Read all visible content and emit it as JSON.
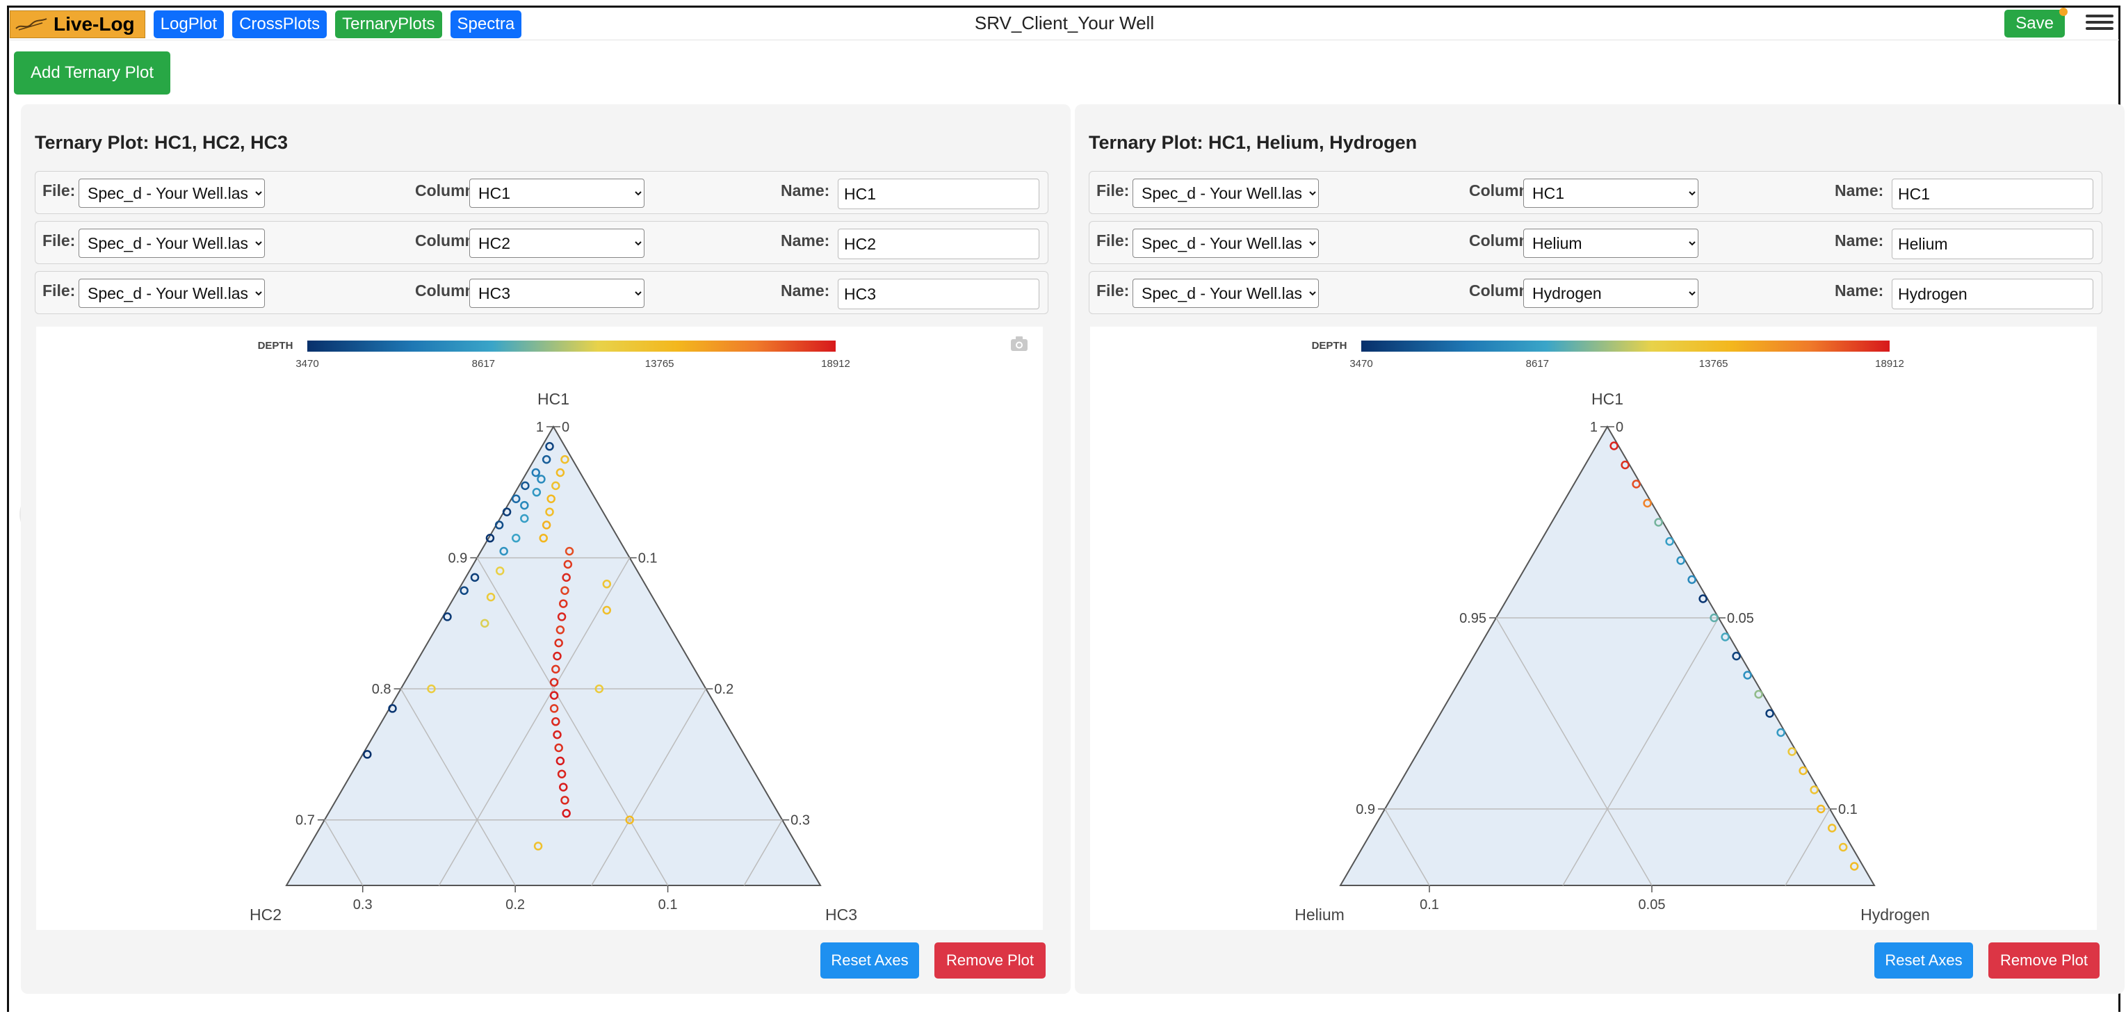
{
  "app": {
    "brand": "Live-Log",
    "window_title": "SRV_Client_Your Well",
    "nav": [
      "LogPlot",
      "CrossPlots",
      "TernaryPlots",
      "Spectra"
    ],
    "active_nav": "TernaryPlots",
    "save_label": "Save",
    "add_label": "Add Ternary Plot"
  },
  "colors": {
    "primary": "#0d6efd",
    "success": "#28a745",
    "danger": "#dc3545",
    "info": "#1e90f0",
    "brand": "#f0a830"
  },
  "panels": [
    {
      "title": "Ternary Plot: HC1, HC2, HC3",
      "rows": [
        {
          "file_label": "File:",
          "file": "Spec_d - Your Well.las",
          "column_label": "Column:",
          "column": "HC1",
          "name_label": "Name:",
          "name": "HC1"
        },
        {
          "file_label": "File:",
          "file": "Spec_d - Your Well.las",
          "column_label": "Column:",
          "column": "HC2",
          "name_label": "Name:",
          "name": "HC2"
        },
        {
          "file_label": "File:",
          "file": "Spec_d - Your Well.las",
          "column_label": "Column:",
          "column": "HC3",
          "name_label": "Name:",
          "name": "HC3"
        }
      ],
      "reset_label": "Reset Axes",
      "remove_label": "Remove Plot"
    },
    {
      "title": "Ternary Plot: HC1, Helium, Hydrogen",
      "rows": [
        {
          "file_label": "File:",
          "file": "Spec_d - Your Well.las",
          "column_label": "Column:",
          "column": "HC1",
          "name_label": "Name:",
          "name": "HC1"
        },
        {
          "file_label": "File:",
          "file": "Spec_d - Your Well.las",
          "column_label": "Column:",
          "column": "Helium",
          "name_label": "Name:",
          "name": "Helium"
        },
        {
          "file_label": "File:",
          "file": "Spec_d - Your Well.las",
          "column_label": "Column:",
          "column": "Hydrogen",
          "name_label": "Name:",
          "name": "Hydrogen"
        }
      ],
      "reset_label": "Reset Axes",
      "remove_label": "Remove Plot"
    }
  ],
  "chart_data": [
    {
      "type": "scatter",
      "subtype": "ternary",
      "colorbar": {
        "title": "DEPTH",
        "ticks": [
          3470,
          8617,
          13765,
          18912
        ],
        "colorscale": [
          "#08306b",
          "#1f78b4",
          "#3aa5c8",
          "#e8d24a",
          "#f3b71e",
          "#ef7a2a",
          "#d7191c"
        ]
      },
      "axes": {
        "a": {
          "title": "HC1",
          "min": 0.65,
          "ticks": [
            "1",
            "0.9",
            "0.8",
            "0.7"
          ]
        },
        "b": {
          "title": "HC2",
          "ticks": [
            "0.3",
            "0.2",
            "0.1"
          ]
        },
        "c": {
          "title": "HC3",
          "ticks": [
            "0",
            "0.1",
            "0.2",
            "0.3"
          ]
        }
      },
      "points": [
        {
          "hc1": 0.985,
          "hc3": 0.005,
          "depth": 4200
        },
        {
          "hc1": 0.975,
          "hc3": 0.008,
          "depth": 5100
        },
        {
          "hc1": 0.965,
          "hc3": 0.006,
          "depth": 6300
        },
        {
          "hc1": 0.955,
          "hc3": 0.004,
          "depth": 4800
        },
        {
          "hc1": 0.945,
          "hc3": 0.003,
          "depth": 5500
        },
        {
          "hc1": 0.935,
          "hc3": 0.002,
          "depth": 3900
        },
        {
          "hc1": 0.925,
          "hc3": 0.002,
          "depth": 4500
        },
        {
          "hc1": 0.915,
          "hc3": 0.001,
          "depth": 3600
        },
        {
          "hc1": 0.96,
          "hc3": 0.012,
          "depth": 7200
        },
        {
          "hc1": 0.95,
          "hc3": 0.014,
          "depth": 7800
        },
        {
          "hc1": 0.94,
          "hc3": 0.011,
          "depth": 7000
        },
        {
          "hc1": 0.93,
          "hc3": 0.016,
          "depth": 8200
        },
        {
          "hc1": 0.915,
          "hc3": 0.018,
          "depth": 8500
        },
        {
          "hc1": 0.905,
          "hc3": 0.015,
          "depth": 7600
        },
        {
          "hc1": 0.885,
          "hc3": 0.006,
          "depth": 4000
        },
        {
          "hc1": 0.875,
          "hc3": 0.004,
          "depth": 4300
        },
        {
          "hc1": 0.855,
          "hc3": 0.003,
          "depth": 3800
        },
        {
          "hc1": 0.785,
          "hc3": 0.002,
          "depth": 3700
        },
        {
          "hc1": 0.75,
          "hc3": 0.003,
          "depth": 3500
        },
        {
          "hc1": 0.89,
          "hc3": 0.02,
          "depth": 11500
        },
        {
          "hc1": 0.87,
          "hc3": 0.024,
          "depth": 12000
        },
        {
          "hc1": 0.85,
          "hc3": 0.03,
          "depth": 11000
        },
        {
          "hc1": 0.8,
          "hc3": 0.02,
          "depth": 11800
        },
        {
          "hc1": 0.975,
          "hc3": 0.02,
          "depth": 13000
        },
        {
          "hc1": 0.965,
          "hc3": 0.022,
          "depth": 13400
        },
        {
          "hc1": 0.955,
          "hc3": 0.024,
          "depth": 12800
        },
        {
          "hc1": 0.945,
          "hc3": 0.026,
          "depth": 13600
        },
        {
          "hc1": 0.935,
          "hc3": 0.03,
          "depth": 13200
        },
        {
          "hc1": 0.925,
          "hc3": 0.033,
          "depth": 14000
        },
        {
          "hc1": 0.915,
          "hc3": 0.036,
          "depth": 13800
        },
        {
          "hc1": 0.905,
          "hc3": 0.058,
          "depth": 17500
        },
        {
          "hc1": 0.895,
          "hc3": 0.062,
          "depth": 18000
        },
        {
          "hc1": 0.885,
          "hc3": 0.066,
          "depth": 18500
        },
        {
          "hc1": 0.875,
          "hc3": 0.07,
          "depth": 17800
        },
        {
          "hc1": 0.865,
          "hc3": 0.074,
          "depth": 18200
        },
        {
          "hc1": 0.855,
          "hc3": 0.078,
          "depth": 18600
        },
        {
          "hc1": 0.845,
          "hc3": 0.082,
          "depth": 17900
        },
        {
          "hc1": 0.835,
          "hc3": 0.086,
          "depth": 18300
        },
        {
          "hc1": 0.825,
          "hc3": 0.09,
          "depth": 18700
        },
        {
          "hc1": 0.815,
          "hc3": 0.094,
          "depth": 18100
        },
        {
          "hc1": 0.805,
          "hc3": 0.098,
          "depth": 18400
        },
        {
          "hc1": 0.795,
          "hc3": 0.103,
          "depth": 18800
        },
        {
          "hc1": 0.785,
          "hc3": 0.108,
          "depth": 18000
        },
        {
          "hc1": 0.775,
          "hc3": 0.114,
          "depth": 18500
        },
        {
          "hc1": 0.765,
          "hc3": 0.12,
          "depth": 18700
        },
        {
          "hc1": 0.755,
          "hc3": 0.126,
          "depth": 18300
        },
        {
          "hc1": 0.745,
          "hc3": 0.132,
          "depth": 18900
        },
        {
          "hc1": 0.735,
          "hc3": 0.138,
          "depth": 18600
        },
        {
          "hc1": 0.725,
          "hc3": 0.144,
          "depth": 18800
        },
        {
          "hc1": 0.715,
          "hc3": 0.15,
          "depth": 18500
        },
        {
          "hc1": 0.705,
          "hc3": 0.156,
          "depth": 18900
        },
        {
          "hc1": 0.88,
          "hc3": 0.095,
          "depth": 12500
        },
        {
          "hc1": 0.86,
          "hc3": 0.105,
          "depth": 13000
        },
        {
          "hc1": 0.8,
          "hc3": 0.13,
          "depth": 12000
        },
        {
          "hc1": 0.7,
          "hc3": 0.2,
          "depth": 13500
        },
        {
          "hc1": 0.68,
          "hc3": 0.15,
          "depth": 12800
        }
      ]
    },
    {
      "type": "scatter",
      "subtype": "ternary",
      "colorbar": {
        "title": "DEPTH",
        "ticks": [
          3470,
          8617,
          13765,
          18912
        ],
        "colorscale": [
          "#08306b",
          "#1f78b4",
          "#3aa5c8",
          "#e8d24a",
          "#f3b71e",
          "#ef7a2a",
          "#d7191c"
        ]
      },
      "axes": {
        "a": {
          "title": "HC1",
          "min": 0.88,
          "ticks": [
            "1",
            "0.95",
            "0.9"
          ]
        },
        "b": {
          "title": "Helium",
          "ticks": [
            "0.1",
            "0.05"
          ]
        },
        "c": {
          "title": "Hydrogen",
          "ticks": [
            "0",
            "0.05",
            "0.1"
          ]
        }
      },
      "points": [
        {
          "hc1": 0.995,
          "h2": 0.004,
          "depth": 18600
        },
        {
          "hc1": 0.99,
          "h2": 0.009,
          "depth": 18300
        },
        {
          "hc1": 0.985,
          "h2": 0.014,
          "depth": 17500
        },
        {
          "hc1": 0.98,
          "h2": 0.019,
          "depth": 16000
        },
        {
          "hc1": 0.975,
          "h2": 0.024,
          "depth": 9500
        },
        {
          "hc1": 0.97,
          "h2": 0.029,
          "depth": 8200
        },
        {
          "hc1": 0.965,
          "h2": 0.034,
          "depth": 7600
        },
        {
          "hc1": 0.96,
          "h2": 0.039,
          "depth": 7000
        },
        {
          "hc1": 0.955,
          "h2": 0.044,
          "depth": 3700
        },
        {
          "hc1": 0.95,
          "h2": 0.049,
          "depth": 9200
        },
        {
          "hc1": 0.945,
          "h2": 0.054,
          "depth": 8800
        },
        {
          "hc1": 0.94,
          "h2": 0.059,
          "depth": 4100
        },
        {
          "hc1": 0.935,
          "h2": 0.064,
          "depth": 7400
        },
        {
          "hc1": 0.93,
          "h2": 0.069,
          "depth": 9900
        },
        {
          "hc1": 0.925,
          "h2": 0.074,
          "depth": 3900
        },
        {
          "hc1": 0.92,
          "h2": 0.079,
          "depth": 8000
        },
        {
          "hc1": 0.915,
          "h2": 0.084,
          "depth": 12200
        },
        {
          "hc1": 0.91,
          "h2": 0.089,
          "depth": 13100
        },
        {
          "hc1": 0.905,
          "h2": 0.094,
          "depth": 12600
        },
        {
          "hc1": 0.9,
          "h2": 0.098,
          "depth": 13500
        },
        {
          "hc1": 0.895,
          "h2": 0.103,
          "depth": 13000
        },
        {
          "hc1": 0.89,
          "h2": 0.108,
          "depth": 12800
        },
        {
          "hc1": 0.885,
          "h2": 0.113,
          "depth": 13300
        }
      ]
    }
  ]
}
